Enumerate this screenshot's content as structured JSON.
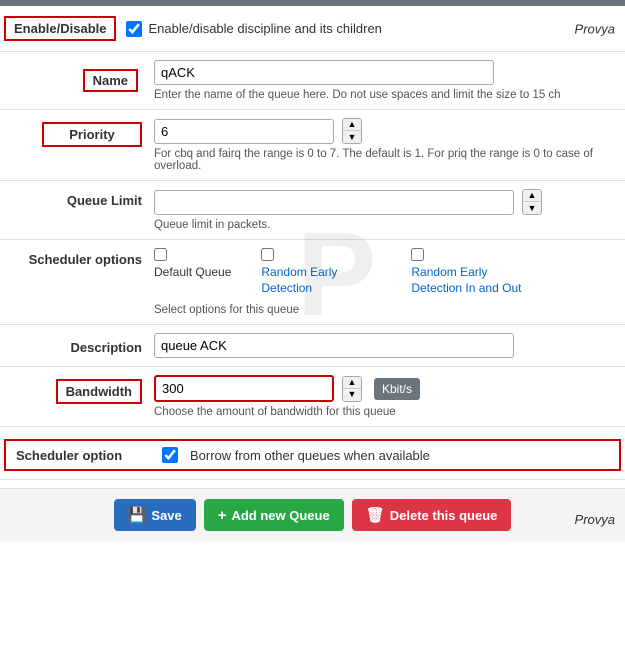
{
  "topbar": {},
  "enable_disable": {
    "label": "Enable/Disable",
    "checked": true,
    "description": "Enable/disable discipline and its children"
  },
  "name_field": {
    "label": "Name",
    "value": "qACK",
    "placeholder": "",
    "hint": "Enter the name of the queue here. Do not use spaces and limit the size to 15 ch"
  },
  "priority_field": {
    "label": "Priority",
    "value": "6",
    "hint": "For cbq and fairq the range is 0 to 7. The default is 1. For priq the range is 0 to case of overload."
  },
  "queue_limit": {
    "label": "Queue Limit",
    "value": "",
    "hint": "Queue limit in packets."
  },
  "scheduler_options": {
    "label": "Scheduler options",
    "options": [
      {
        "id": "default_queue",
        "label": "Default Queue",
        "checked": false,
        "colored": false
      },
      {
        "id": "red",
        "label": "Random Early Detection",
        "checked": false,
        "colored": true
      },
      {
        "id": "red_io",
        "label": "Random Early Detection In and Out",
        "checked": false,
        "colored": true
      }
    ],
    "hint": "Select options for this queue"
  },
  "description": {
    "label": "Description",
    "value": "queue ACK"
  },
  "bandwidth": {
    "label": "Bandwidth",
    "value": "300",
    "unit": "Kbit/s",
    "hint": "Choose the amount of bandwidth for this queue"
  },
  "scheduler_option": {
    "label": "Scheduler option",
    "checkbox_label": "Borrow from other queues when available",
    "checked": true
  },
  "buttons": {
    "save": "Save",
    "add": "Add new Queue",
    "delete": "Delete this queue"
  },
  "provya": "Provya"
}
